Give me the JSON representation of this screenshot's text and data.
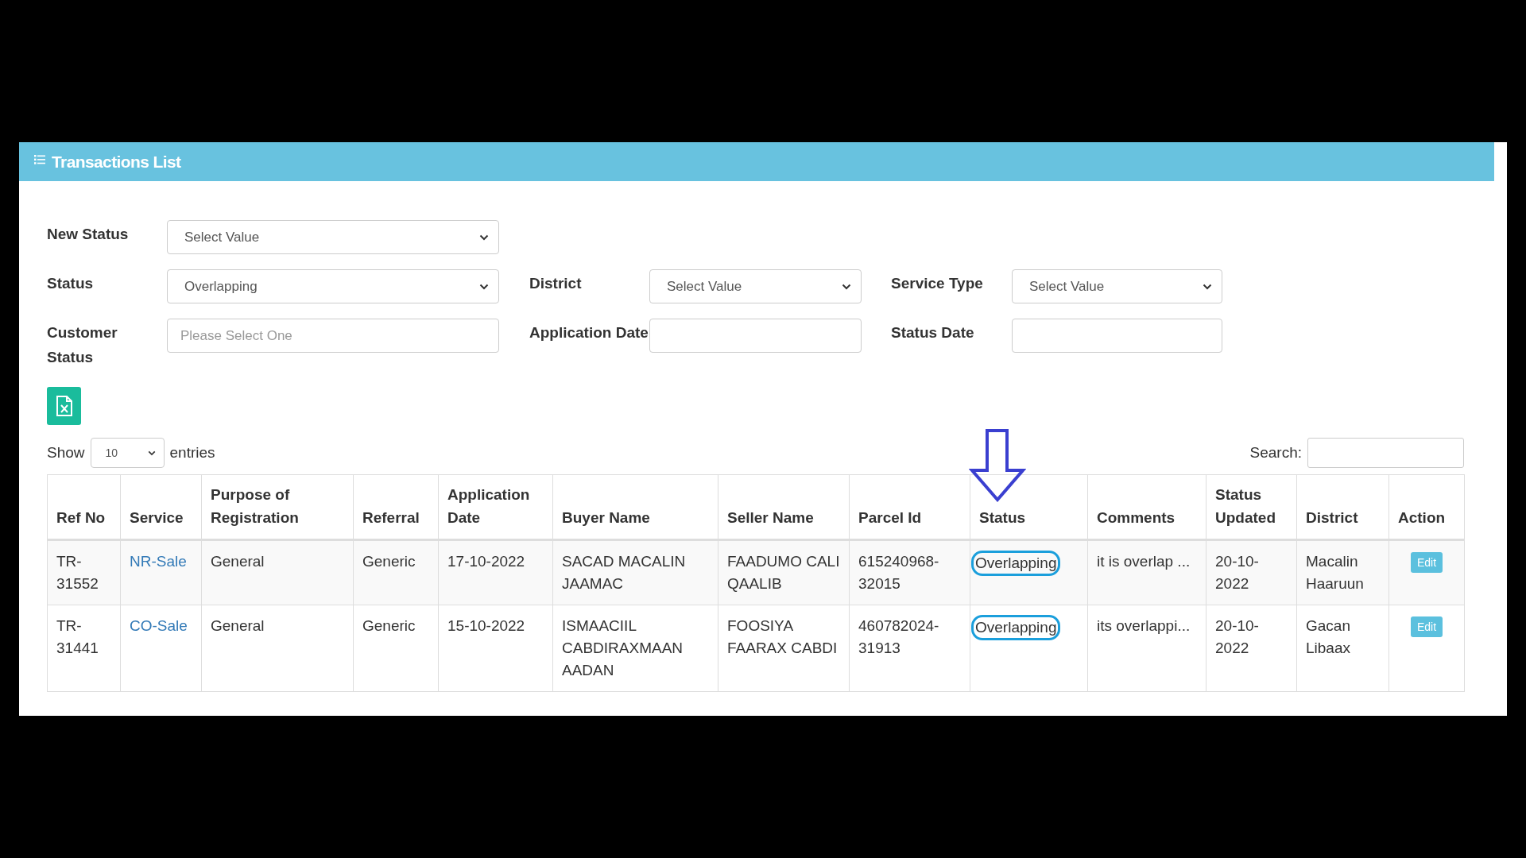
{
  "header": {
    "title": "Transactions List"
  },
  "filter_rows": [
    [
      {
        "label": "New Status",
        "kind": "select",
        "value": "Select Value"
      }
    ],
    [
      {
        "label": "Status",
        "kind": "select",
        "value": "Overlapping"
      },
      {
        "label": "District",
        "kind": "select",
        "value": "Select Value"
      },
      {
        "label": "Service Type",
        "kind": "select",
        "value": "Select Value"
      }
    ],
    [
      {
        "label": "Customer Status",
        "kind": "text",
        "placeholder": "Please Select One"
      },
      {
        "label": "Application Date",
        "kind": "text"
      },
      {
        "label": "Status Date",
        "kind": "text"
      }
    ]
  ],
  "length_control": {
    "label_before": "Show",
    "value": "10",
    "label_after": "entries"
  },
  "search": {
    "label": "Search:"
  },
  "table": {
    "columns": [
      "Ref No",
      "Service",
      "Purpose of Registration",
      "Referral",
      "Application Date",
      "Buyer Name",
      "Seller Name",
      "Parcel Id",
      "Status",
      "Comments",
      "Status Updated",
      "District",
      "Action"
    ],
    "rows": [
      {
        "ref_no": "TR-31552",
        "service": "NR-Sale",
        "purpose": "General",
        "referral": "Generic",
        "application_date": "17-10-2022",
        "buyer": "SACAD MACALIN JAAMAC",
        "seller": "FAADUMO CALI QAALIB",
        "parcel_id": "615240968-32015",
        "status": "Overlapping",
        "comments": "it is overlap ...",
        "status_updated": "20-10-2022",
        "district": "Macalin Haaruun",
        "action": "Edit"
      },
      {
        "ref_no": "TR-31441",
        "service": "CO-Sale",
        "purpose": "General",
        "referral": "Generic",
        "application_date": "15-10-2022",
        "buyer": "ISMAACIIL CABDIRAXMAAN AADAN",
        "seller": "FOOSIYA FAARAX CABDI",
        "parcel_id": "460782024-31913",
        "status": "Overlapping",
        "comments": "its overlappi...",
        "status_updated": "20-10-2022",
        "district": "Gacan Libaax",
        "action": "Edit"
      }
    ]
  }
}
